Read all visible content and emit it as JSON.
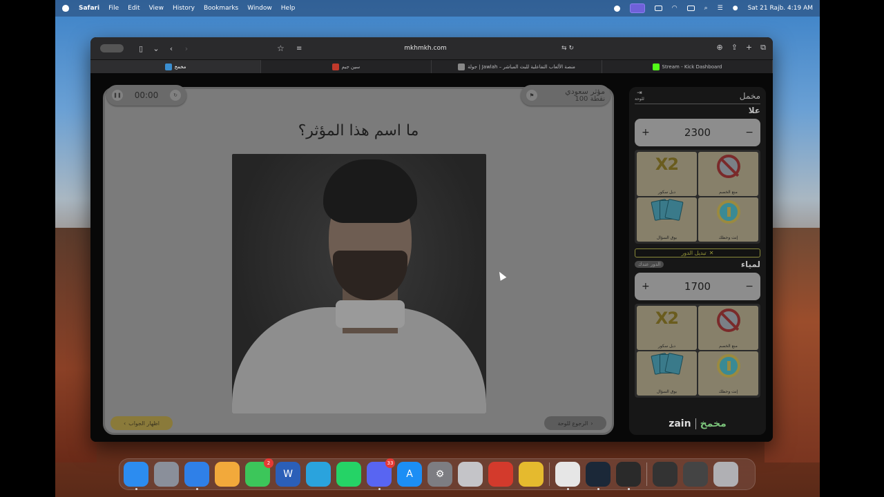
{
  "menubar": {
    "app": "Safari",
    "menus": [
      "File",
      "Edit",
      "View",
      "History",
      "Bookmarks",
      "Window",
      "Help"
    ],
    "datetime": "Sat 21 Rajb.  4:19 AM"
  },
  "browser": {
    "url": "mkhmkh.com",
    "tabs": [
      {
        "label": "مخمخ",
        "active": true,
        "color": "#3a8ed0"
      },
      {
        "label": "سين جيم",
        "active": false,
        "color": "#c0392b"
      },
      {
        "label": "جولة | Jawlah – منصة الألعاب التفاعلية للبث المباشر",
        "active": false,
        "color": "#888888"
      },
      {
        "label": "Stream - Kick Dashboard",
        "active": false,
        "color": "#53fc18"
      }
    ]
  },
  "game": {
    "timer": "00:00",
    "category_name": "مؤثر سعودي",
    "category_points": "100 نقطة",
    "question": "ما اسم هذا المؤثر؟",
    "show_answer_label": "اظهار الجواب",
    "back_to_board_label": "الرجوع للوحة"
  },
  "sidebar": {
    "title": "مخمل",
    "back_label": "للوحة",
    "swap_label": "تبديل الدور",
    "turn_badge": "الدور عندك",
    "teams": [
      {
        "name": "علا",
        "score": "2300",
        "powers": [
          {
            "label": "دبل سكور",
            "icon": "x2-icon",
            "text": "X2"
          },
          {
            "label": "منع الخصم",
            "icon": "ban-icon"
          },
          {
            "label": "بوق السؤال",
            "icon": "cards-icon"
          },
          {
            "label": "إنت وحظك",
            "icon": "wheel-icon"
          }
        ]
      },
      {
        "name": "لمياء",
        "score": "1700",
        "powers": [
          {
            "label": "دبل سكور",
            "icon": "x2-icon",
            "text": "X2"
          },
          {
            "label": "منع الخصم",
            "icon": "ban-icon"
          },
          {
            "label": "بوق السؤال",
            "icon": "cards-icon"
          },
          {
            "label": "إنت وحظك",
            "icon": "wheel-icon"
          }
        ]
      }
    ],
    "footer_brand1": "zain",
    "footer_brand2": "مخمخ"
  },
  "dock": {
    "apps": [
      {
        "name": "finder",
        "color": "#2c8cf0"
      },
      {
        "name": "launchpad",
        "color": "#8a8f9a"
      },
      {
        "name": "safari",
        "color": "#2f80e8"
      },
      {
        "name": "photos",
        "color": "#f2a93b"
      },
      {
        "name": "facetime",
        "color": "#3cc65a",
        "badge": "2"
      },
      {
        "name": "word",
        "color": "#2b5fb8"
      },
      {
        "name": "telegram",
        "color": "#2aa3dd"
      },
      {
        "name": "whatsapp",
        "color": "#25d366"
      },
      {
        "name": "discord",
        "color": "#5865f2",
        "badge": "33"
      },
      {
        "name": "app-store",
        "color": "#1c8ef5"
      },
      {
        "name": "system-settings",
        "color": "#7d7d82"
      },
      {
        "name": "iphone-mirroring",
        "color": "#c4c4c8"
      },
      {
        "name": "parallels",
        "color": "#d33a2c"
      },
      {
        "name": "chrome",
        "color": "#e5ba2e"
      }
    ],
    "apps2": [
      {
        "name": "printer",
        "color": "#e6e6e6"
      },
      {
        "name": "steam",
        "color": "#1b2838"
      },
      {
        "name": "obs",
        "color": "#2a2a2a"
      }
    ],
    "recent": [
      {
        "name": "window-thumb-1",
        "color": "#333"
      },
      {
        "name": "window-thumb-2",
        "color": "#444"
      }
    ],
    "trash": {
      "name": "trash",
      "color": "#b0b0b4"
    }
  }
}
